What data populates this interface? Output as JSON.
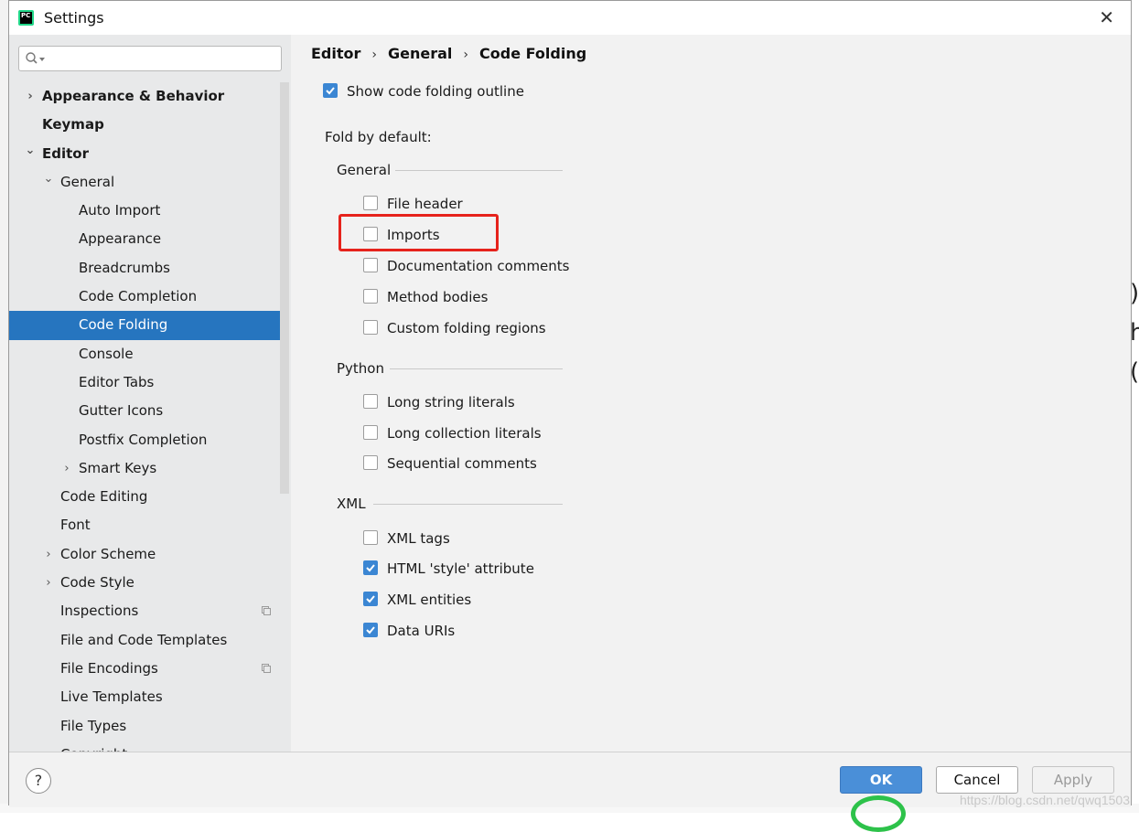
{
  "window": {
    "title": "Settings",
    "app_icon_text": "PC"
  },
  "search": {
    "placeholder": ""
  },
  "sidebar": {
    "items": [
      {
        "label": "Appearance & Behavior",
        "arrow": "›"
      },
      {
        "label": "Keymap"
      },
      {
        "label": "Editor",
        "arrow": "⌄"
      },
      {
        "label": "General",
        "arrow": "⌄"
      },
      {
        "label": "Auto Import"
      },
      {
        "label": "Appearance"
      },
      {
        "label": "Breadcrumbs"
      },
      {
        "label": "Code Completion"
      },
      {
        "label": "Code Folding",
        "selected": true
      },
      {
        "label": "Console"
      },
      {
        "label": "Editor Tabs"
      },
      {
        "label": "Gutter Icons"
      },
      {
        "label": "Postfix Completion"
      },
      {
        "label": "Smart Keys",
        "arrow": "›"
      },
      {
        "label": "Code Editing"
      },
      {
        "label": "Font"
      },
      {
        "label": "Color Scheme",
        "arrow": "›"
      },
      {
        "label": "Code Style",
        "arrow": "›"
      },
      {
        "label": "Inspections"
      },
      {
        "label": "File and Code Templates"
      },
      {
        "label": "File Encodings"
      },
      {
        "label": "Live Templates"
      },
      {
        "label": "File Types"
      },
      {
        "label": "Copyright",
        "arrow": "›"
      }
    ]
  },
  "breadcrumb": {
    "part1": "Editor",
    "part2": "General",
    "part3": "Code Folding",
    "sep": "›"
  },
  "main": {
    "show_outline": {
      "label": "Show code folding outline",
      "checked": true
    },
    "fold_by_default_label": "Fold by default:",
    "groups": {
      "general": {
        "title": "General",
        "options": [
          {
            "label": "File header",
            "checked": false
          },
          {
            "label": "Imports",
            "checked": false
          },
          {
            "label": "Documentation comments",
            "checked": false
          },
          {
            "label": "Method bodies",
            "checked": false
          },
          {
            "label": "Custom folding regions",
            "checked": false
          }
        ]
      },
      "python": {
        "title": "Python",
        "options": [
          {
            "label": "Long string literals",
            "checked": false
          },
          {
            "label": "Long collection literals",
            "checked": false
          },
          {
            "label": "Sequential comments",
            "checked": false
          }
        ]
      },
      "xml": {
        "title": "XML",
        "options": [
          {
            "label": "XML tags",
            "checked": false
          },
          {
            "label": "HTML 'style' attribute",
            "checked": true
          },
          {
            "label": "XML entities",
            "checked": true
          },
          {
            "label": "Data URIs",
            "checked": true
          }
        ]
      }
    }
  },
  "footer": {
    "help": "?",
    "ok": "OK",
    "cancel": "Cancel",
    "apply": "Apply"
  },
  "background": {
    "edge_glyphs": [
      ")",
      "h",
      "("
    ],
    "watermark": "https://blog.csdn.net/qwq1503"
  },
  "colors": {
    "selection": "#2675bf",
    "checkbox_checked": "#3b86d3",
    "highlight_box": "#e6231c",
    "ok_button": "#4a8fd8"
  }
}
